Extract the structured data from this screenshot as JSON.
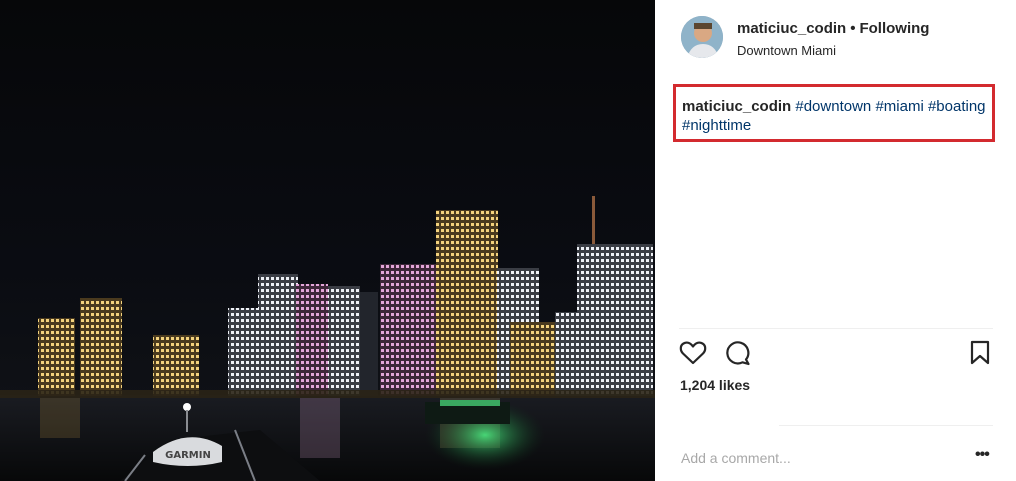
{
  "post": {
    "photo": {
      "alt": "",
      "equipment_label": "GARMIN",
      "icon": "city-skyline-image"
    },
    "header": {
      "username": "maticiuc_codin",
      "separator": "•",
      "follow_status": "Following",
      "location": "Downtown Miami",
      "avatar_icon": "profile-avatar"
    },
    "caption": {
      "username": "maticiuc_codin",
      "hashtags": [
        "#downtown",
        "#miami",
        "#boating",
        "#nighttime"
      ],
      "highlight_color": "#d32a2f"
    },
    "actions": {
      "like_icon": "heart-icon",
      "comment_icon": "comment-icon",
      "save_icon": "bookmark-icon",
      "likes_text": "1,204 likes"
    },
    "comment": {
      "placeholder": "Add a comment...",
      "more_label": "•••"
    }
  }
}
